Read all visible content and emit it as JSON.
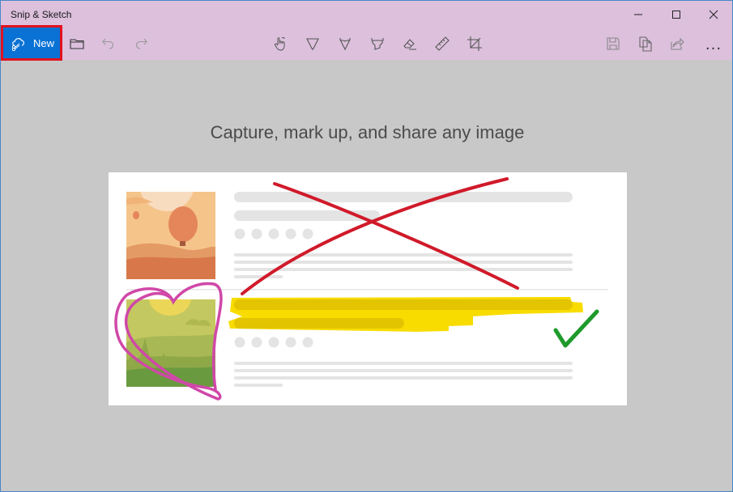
{
  "window": {
    "title": "Snip & Sketch",
    "controls": {
      "minimize_icon": "minimize-icon",
      "maximize_icon": "maximize-icon",
      "close_icon": "close-icon"
    }
  },
  "toolbar": {
    "new_label": "New",
    "new_icon": "snip-cloud-icon",
    "left_tools": [
      {
        "name": "open-file",
        "icon": "folder-icon"
      },
      {
        "name": "undo",
        "icon": "undo-icon"
      },
      {
        "name": "redo",
        "icon": "redo-icon"
      }
    ],
    "center_tools": [
      {
        "name": "touch-writing",
        "icon": "touch-writing-icon"
      },
      {
        "name": "ballpoint-pen",
        "icon": "ballpoint-pen-icon"
      },
      {
        "name": "pencil",
        "icon": "pencil-icon"
      },
      {
        "name": "highlighter",
        "icon": "highlighter-icon"
      },
      {
        "name": "eraser",
        "icon": "eraser-icon"
      },
      {
        "name": "ruler",
        "icon": "ruler-icon"
      },
      {
        "name": "crop",
        "icon": "crop-icon"
      }
    ],
    "right_tools": [
      {
        "name": "save",
        "icon": "save-icon"
      },
      {
        "name": "copy",
        "icon": "copy-icon"
      },
      {
        "name": "share",
        "icon": "share-icon"
      }
    ],
    "more_label": "..."
  },
  "main": {
    "tagline": "Capture, mark up, and share any image"
  },
  "colors": {
    "titlebar": "#dcc0dc",
    "new_button": "#0a72d4",
    "highlight_border": "#e1121e",
    "background": "#c8c8c8",
    "red_ink": "#d01a2a",
    "pink_ink": "#d048a8",
    "yellow_highlight": "#f8dc00",
    "green_check": "#1e9a2a"
  }
}
